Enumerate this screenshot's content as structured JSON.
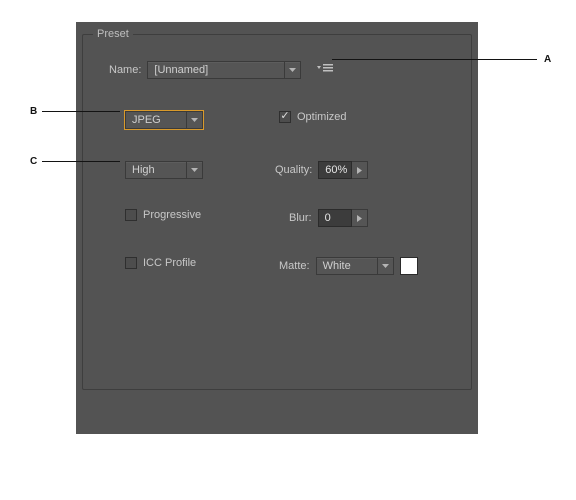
{
  "panel": {
    "legend": "Preset",
    "name_label": "Name:",
    "name_value": "[Unnamed]",
    "format_value": "JPEG",
    "optimized_label": "Optimized",
    "optimized_checked": true,
    "quality_preset": "High",
    "quality_label": "Quality:",
    "quality_value": "60%",
    "progressive_label": "Progressive",
    "progressive_checked": false,
    "blur_label": "Blur:",
    "blur_value": "0",
    "icc_label": "ICC Profile",
    "icc_checked": false,
    "matte_label": "Matte:",
    "matte_value": "White",
    "matte_swatch": "#ffffff"
  },
  "callouts": {
    "a": "A",
    "b": "B",
    "c": "C"
  }
}
